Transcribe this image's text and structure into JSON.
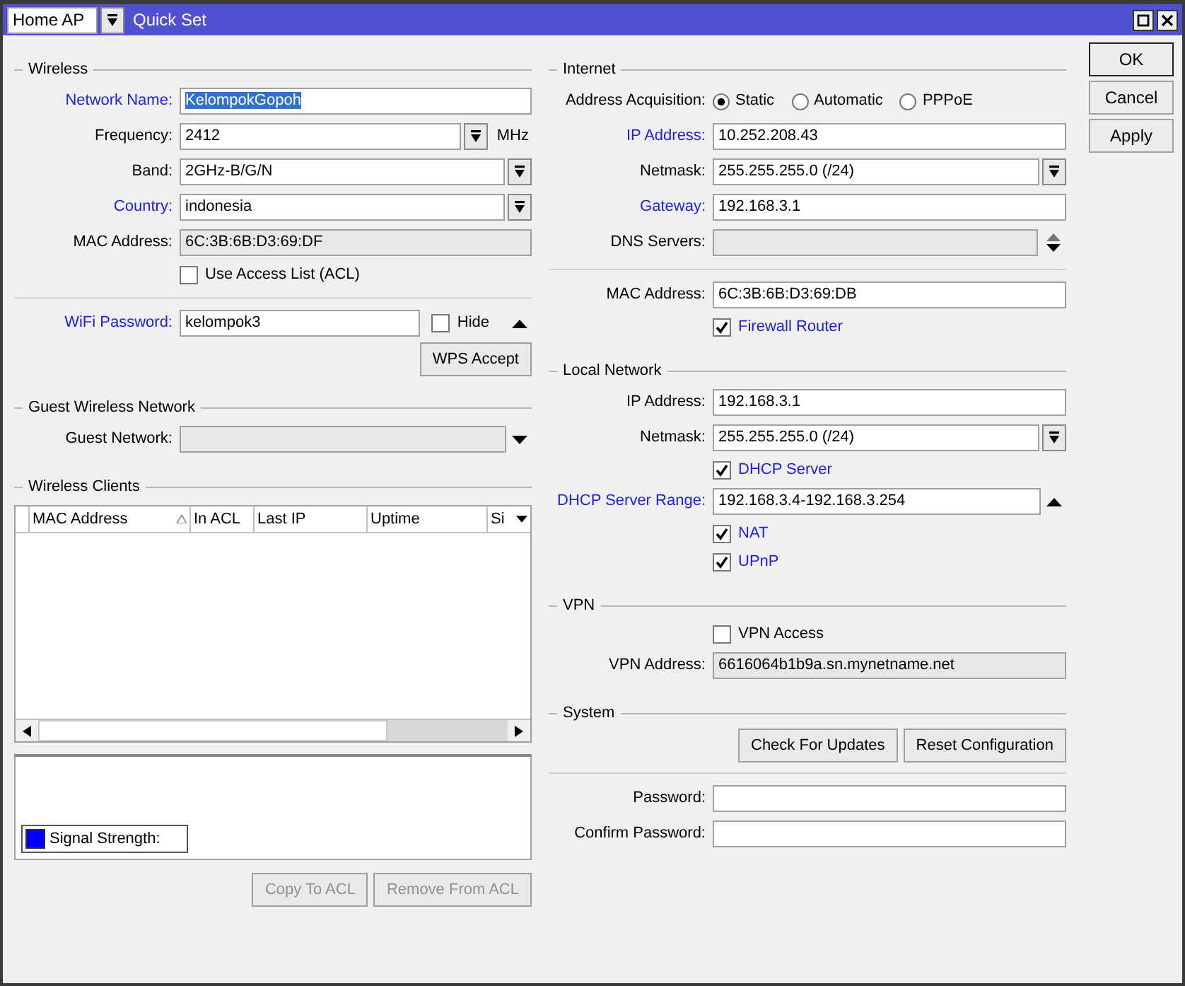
{
  "window": {
    "mode": "Home AP",
    "title": "Quick Set"
  },
  "left_column": [
    {
      "heading": "Wireless",
      "rows": [
        {
          "kind": "text_field",
          "label": "Network Name:",
          "linked": true,
          "value": "KelompokGopoh",
          "text_selected": true
        },
        {
          "kind": "combo_field",
          "label": "Frequency:",
          "linked": false,
          "value": "2412",
          "unit": "MHz"
        },
        {
          "kind": "combo_field",
          "label": "Band:",
          "linked": false,
          "value": "2GHz-B/G/N"
        },
        {
          "kind": "combo_field",
          "label": "Country:",
          "linked": true,
          "value": "indonesia"
        },
        {
          "kind": "text_field",
          "label": "MAC Address:",
          "linked": false,
          "value": "6C:3B:6B:D3:69:DF",
          "disabled": true
        },
        {
          "kind": "checkbox",
          "label": "Use Access List (ACL)",
          "linked": false,
          "checked": false
        },
        {
          "kind": "divider"
        },
        {
          "kind": "text_field",
          "label": "WiFi Password:",
          "linked": true,
          "value": "kelompok3",
          "hide": {
            "label": "Hide",
            "checked": false
          },
          "expander": {
            "kind": "up"
          }
        },
        {
          "kind": "buttons",
          "buttons": [
            {
              "label": "WPS Accept",
              "disabled": false
            }
          ]
        }
      ]
    },
    {
      "heading": "Guest Wireless Network",
      "rows": [
        {
          "kind": "text_field",
          "label": "Guest Network:",
          "linked": false,
          "disabled": true,
          "expander": {
            "kind": "down"
          }
        }
      ]
    },
    {
      "heading": "Wireless Clients",
      "rows": [
        {
          "kind": "table",
          "columns": [
            {
              "label": "MAC Address",
              "sorted": true
            },
            {
              "label": "In ACL",
              "sorted": false
            },
            {
              "label": "Last IP",
              "sorted": false
            },
            {
              "label": "Uptime",
              "sorted": false
            },
            {
              "label": "Si",
              "sorted": false
            }
          ]
        },
        {
          "kind": "signal_graph",
          "legend": {
            "label": "Signal Strength:",
            "color": "#0000ff"
          }
        },
        {
          "kind": "buttons",
          "buttons": [
            {
              "label": "Copy To ACL",
              "disabled": true
            },
            {
              "label": "Remove From ACL",
              "disabled": true
            }
          ]
        }
      ]
    }
  ],
  "right_column": [
    {
      "heading": "Internet",
      "rows": [
        {
          "kind": "radio",
          "label": "Address Acquisition:",
          "options": [
            {
              "label": "Static",
              "selected": true
            },
            {
              "label": "Automatic",
              "selected": false
            },
            {
              "label": "PPPoE",
              "selected": false
            }
          ]
        },
        {
          "kind": "text_field",
          "label": "IP Address:",
          "linked": true,
          "value": "10.252.208.43"
        },
        {
          "kind": "combo_field",
          "label": "Netmask:",
          "linked": false,
          "value": "255.255.255.0 (/24)"
        },
        {
          "kind": "text_field",
          "label": "Gateway:",
          "linked": true,
          "value": "192.168.3.1"
        },
        {
          "kind": "text_field",
          "label": "DNS Servers:",
          "linked": false,
          "disabled": true,
          "expander": {
            "kind": "updown"
          }
        },
        {
          "kind": "divider"
        },
        {
          "kind": "text_field",
          "label": "MAC Address:",
          "linked": false,
          "value": "6C:3B:6B:D3:69:DB"
        },
        {
          "kind": "checkbox",
          "label": "Firewall Router",
          "linked": true,
          "checked": true
        }
      ]
    },
    {
      "heading": "Local Network",
      "rows": [
        {
          "kind": "text_field",
          "label": "IP Address:",
          "linked": false,
          "value": "192.168.3.1"
        },
        {
          "kind": "combo_field",
          "label": "Netmask:",
          "linked": false,
          "value": "255.255.255.0 (/24)"
        },
        {
          "kind": "checkbox",
          "label": "DHCP Server",
          "linked": true,
          "checked": true
        },
        {
          "kind": "text_field",
          "label": "DHCP Server Range:",
          "linked": true,
          "value": "192.168.3.4-192.168.3.254",
          "expander": {
            "kind": "up"
          }
        },
        {
          "kind": "checkbox",
          "label": "NAT",
          "linked": true,
          "checked": true
        },
        {
          "kind": "checkbox",
          "label": "UPnP",
          "linked": true,
          "checked": true
        }
      ]
    },
    {
      "heading": "VPN",
      "rows": [
        {
          "kind": "checkbox",
          "label": "VPN Access",
          "linked": false,
          "checked": false
        },
        {
          "kind": "text_field",
          "label": "VPN Address:",
          "linked": false,
          "value": "6616064b1b9a.sn.mynetname.net",
          "disabled": true
        }
      ]
    },
    {
      "heading": "System",
      "rows": [
        {
          "kind": "buttons",
          "buttons": [
            {
              "label": "Check For Updates",
              "disabled": false
            },
            {
              "label": "Reset Configuration",
              "disabled": false
            }
          ]
        },
        {
          "kind": "divider"
        },
        {
          "kind": "text_field",
          "label": "Password:",
          "linked": false
        },
        {
          "kind": "text_field",
          "label": "Confirm Password:",
          "linked": false
        }
      ]
    }
  ],
  "dialog_buttons": [
    {
      "label": "OK",
      "default": true
    },
    {
      "label": "Cancel",
      "default": false
    },
    {
      "label": "Apply",
      "default": false
    }
  ]
}
